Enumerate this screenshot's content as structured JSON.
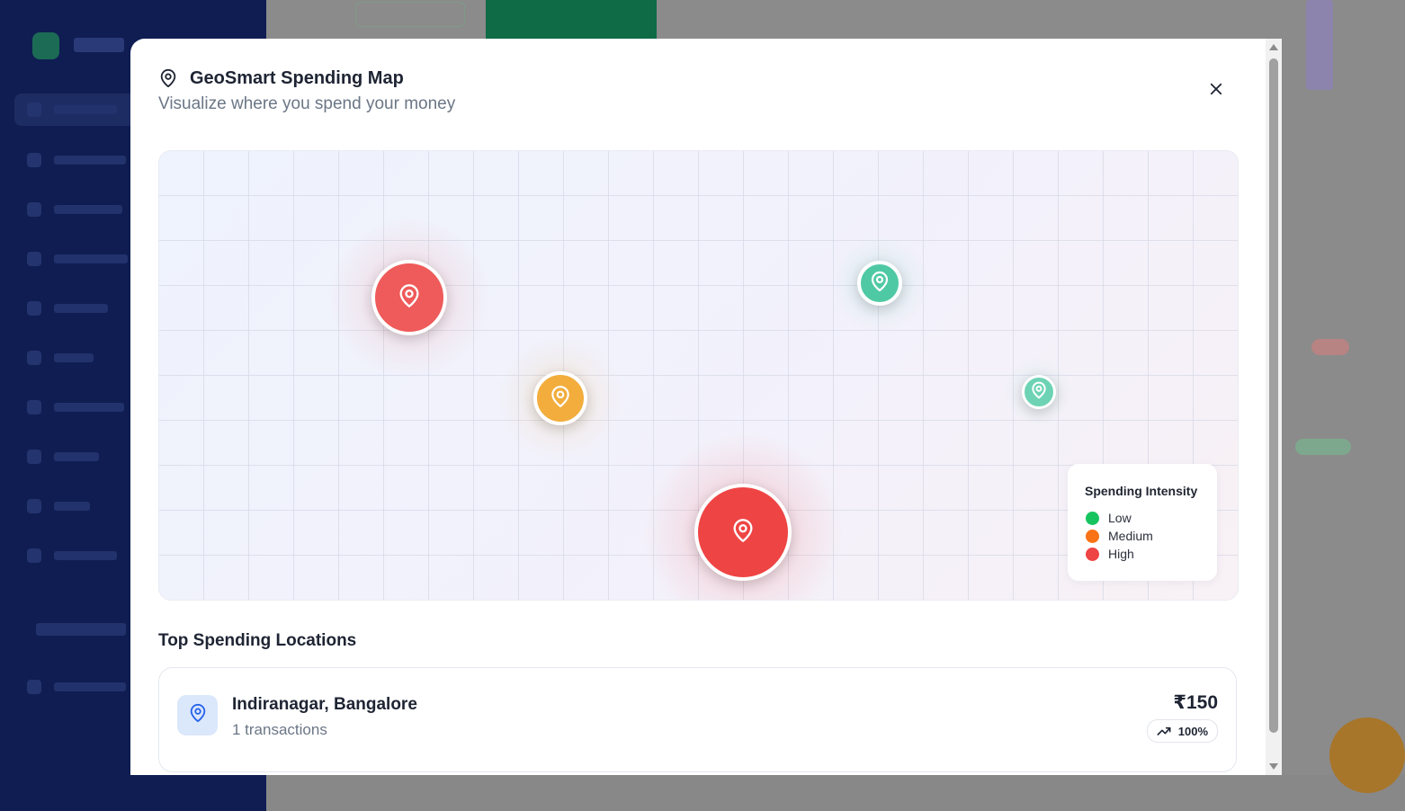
{
  "modal": {
    "title": "GeoSmart Spending Map",
    "subtitle": "Visualize where you spend your money",
    "close_icon": "close-icon",
    "header_icon": "map-pin-icon"
  },
  "map": {
    "markers": [
      {
        "name": "marker-high-large",
        "intensity": "High",
        "color": "#ef4444",
        "icon": "map-pin-icon"
      },
      {
        "name": "marker-high",
        "intensity": "High",
        "color": "#ef5a5a",
        "icon": "map-pin-icon"
      },
      {
        "name": "marker-medium",
        "intensity": "Medium",
        "color": "#f2ad3c",
        "icon": "map-pin-icon"
      },
      {
        "name": "marker-low",
        "intensity": "Low",
        "color": "#4fc9a4",
        "icon": "map-pin-icon"
      },
      {
        "name": "marker-low-small",
        "intensity": "Low",
        "color": "#6dd3b4",
        "icon": "map-pin-icon"
      }
    ],
    "legend": {
      "title": "Spending Intensity",
      "items": [
        {
          "label": "Low",
          "color": "#16c45f"
        },
        {
          "label": "Medium",
          "color": "#f97316"
        },
        {
          "label": "High",
          "color": "#ef4444"
        }
      ]
    }
  },
  "top_locations": {
    "title": "Top Spending Locations",
    "items": [
      {
        "name": "Indiranagar, Bangalore",
        "transactions": "1 transactions",
        "amount": "₹150",
        "percent": "100%",
        "icon": "map-pin-icon",
        "trend_icon": "trending-up-icon"
      }
    ]
  }
}
